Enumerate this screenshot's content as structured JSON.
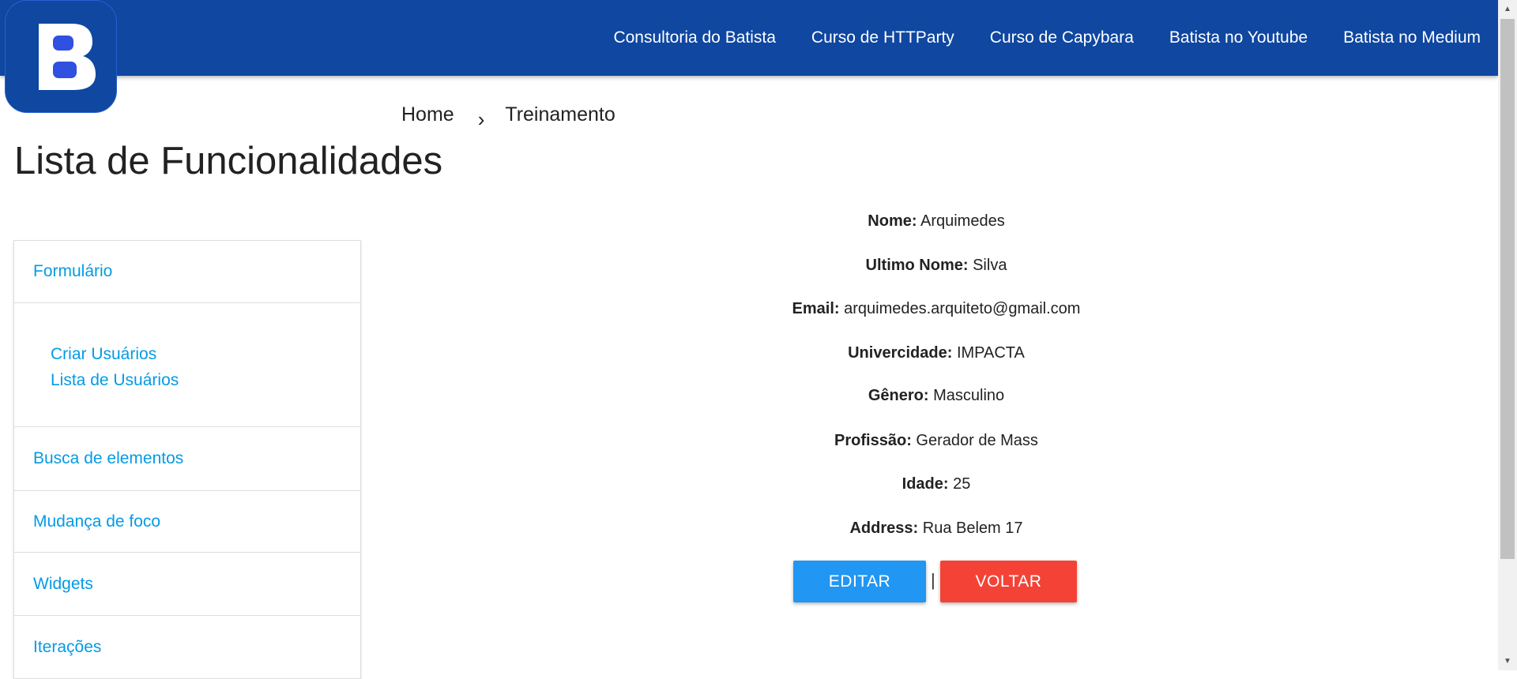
{
  "header": {
    "logo_letter": "B",
    "nav": [
      "Consultoria do Batista",
      "Curso de HTTParty",
      "Curso de Capybara",
      "Batista no Youtube",
      "Batista no Medium"
    ]
  },
  "sidebar": {
    "title": "Lista de Funcionalidades",
    "items": [
      {
        "label": "Formulário",
        "children": [
          "Criar Usuários",
          "Lista de Usuários"
        ]
      },
      {
        "label": "Busca de elementos"
      },
      {
        "label": "Mudança de foco"
      },
      {
        "label": "Widgets"
      },
      {
        "label": "Iterações"
      }
    ]
  },
  "breadcrumb": {
    "home": "Home",
    "current": "Treinamento"
  },
  "details": [
    {
      "label": "Nome:",
      "value": "Arquimedes"
    },
    {
      "label": "Ultimo Nome:",
      "value": "Silva"
    },
    {
      "label": "Email:",
      "value": "arquimedes.arquiteto@gmail.com"
    },
    {
      "label": "Univercidade:",
      "value": "IMPACTA"
    },
    {
      "label": "Gênero:",
      "value": "Masculino"
    },
    {
      "label": "Profissão:",
      "value": "Gerador de Mass"
    },
    {
      "label": "Idade:",
      "value": "25"
    },
    {
      "label": "Address:",
      "value": "Rua Belem 17"
    }
  ],
  "actions": {
    "edit": "EDITAR",
    "separator": "|",
    "back": "VOLTAR"
  },
  "colors": {
    "header": "#0f47a1",
    "link": "#039be5",
    "edit": "#2196f3",
    "back": "#f44336"
  }
}
